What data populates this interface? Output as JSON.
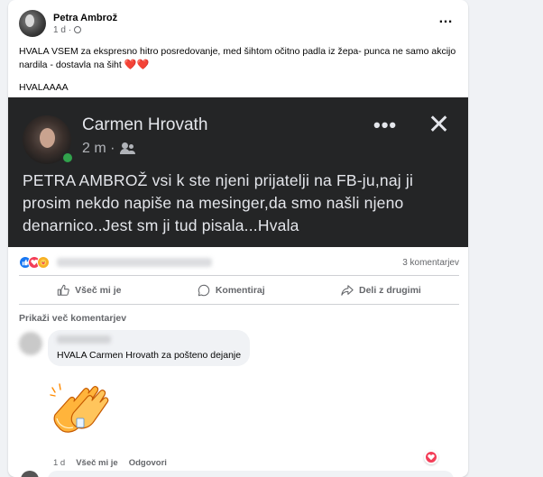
{
  "post": {
    "author": "Petra Ambrož",
    "time": "1 d",
    "text_line1": "HVALA VSEM za ekspresno hitro posredovanje, med šihtom očitno padla iz žepa- punca ne samo akcijo nardila - dostavla na šiht",
    "hearts": "❤️❤️",
    "text_line2": "HVALAAAA",
    "more_icon": "…"
  },
  "screenshot": {
    "name": "Carmen Hrovath",
    "time": "2 m ·",
    "more_icon": "•••",
    "close_icon": "✕",
    "text": "PETRA AMBROŽ vsi k ste njeni prijatelji na FB-ju,naj ji prosim nekdo napiše na mesinger,da smo našli njeno denarnico..Jest sm ji tud pisala...Hvala"
  },
  "stats": {
    "comment_count": "3 komentarjev"
  },
  "actions": {
    "like": "Všeč mi je",
    "comment": "Komentiraj",
    "share": "Deli z drugimi"
  },
  "comments": {
    "show_more": "Prikaži več komentarjev",
    "text": "HVALA Carmen Hrovath za pošteno dejanje",
    "time": "1 d",
    "like": "Všeč mi je",
    "reply": "Odgovori"
  },
  "colors": {
    "accent": "#1877f2",
    "love": "#f33e58",
    "dark_bg": "#242526"
  }
}
